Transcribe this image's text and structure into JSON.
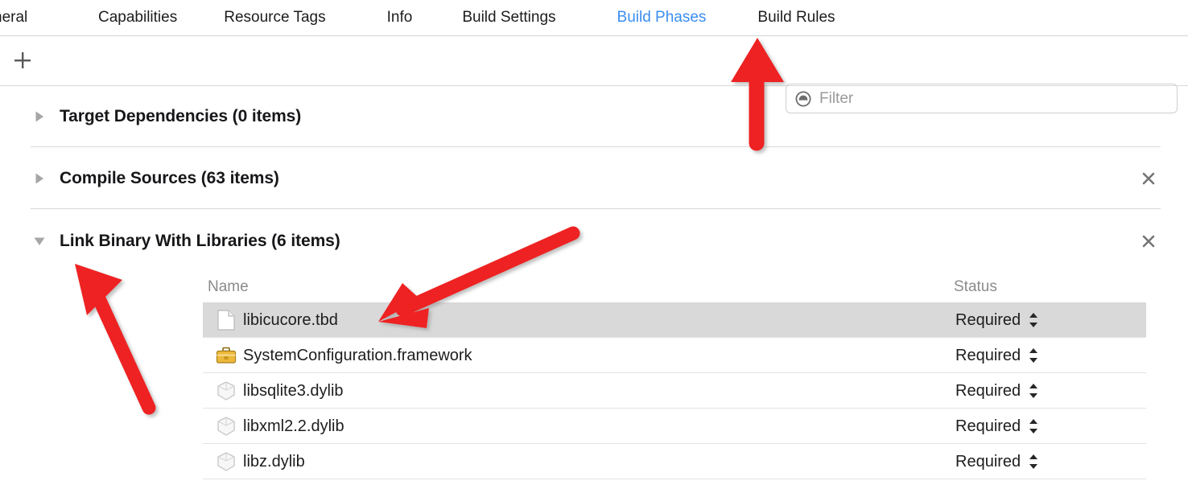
{
  "tabs": [
    {
      "label": "neral",
      "active": false
    },
    {
      "label": "Capabilities",
      "active": false
    },
    {
      "label": "Resource Tags",
      "active": false
    },
    {
      "label": "Info",
      "active": false
    },
    {
      "label": "Build Settings",
      "active": false
    },
    {
      "label": "Build Phases",
      "active": true
    },
    {
      "label": "Build Rules",
      "active": false
    }
  ],
  "toolbar": {
    "add_label": "+",
    "add_icon": "plus-icon",
    "filter": {
      "placeholder": "Filter",
      "value": "",
      "icon": "filter-icon"
    }
  },
  "phases": [
    {
      "title": "Target Dependencies (0 items)",
      "expanded": false,
      "disclosure_icon": "triangle-right-icon",
      "deletable": false,
      "delete_label": "×"
    },
    {
      "title": "Compile Sources (63 items)",
      "expanded": false,
      "disclosure_icon": "triangle-right-icon",
      "deletable": true,
      "delete_label": "×"
    },
    {
      "title": "Link Binary With Libraries (6 items)",
      "expanded": true,
      "disclosure_icon": "triangle-down-icon",
      "deletable": true,
      "delete_label": "×"
    }
  ],
  "library_table": {
    "columns": {
      "name": "Name",
      "status": "Status"
    },
    "rows": [
      {
        "name": "libicucore.tbd",
        "status": "Required",
        "icon": "document-icon",
        "selected": true
      },
      {
        "name": "SystemConfiguration.framework",
        "status": "Required",
        "icon": "toolbox-icon",
        "selected": false
      },
      {
        "name": "libsqlite3.dylib",
        "status": "Required",
        "icon": "cube-icon",
        "selected": false
      },
      {
        "name": "libxml2.2.dylib",
        "status": "Required",
        "icon": "cube-icon",
        "selected": false
      },
      {
        "name": "libz.dylib",
        "status": "Required",
        "icon": "cube-icon",
        "selected": false
      }
    ],
    "status_stepper_icon": "chevron-up-down-icon"
  },
  "annotations": [
    {
      "name": "arrow-to-build-phases-tab",
      "direction": "up"
    },
    {
      "name": "arrow-to-disclosure-triangle",
      "direction": "up-left"
    },
    {
      "name": "arrow-to-libicucore-row",
      "direction": "down-left"
    }
  ],
  "colors": {
    "accent_tab": "#3b8ef0",
    "annotation_red": "#ee2020",
    "selected_row": "#d9d9d9",
    "header_text": "#8b8b8b",
    "toolbox_yellow": "#e8b737"
  }
}
